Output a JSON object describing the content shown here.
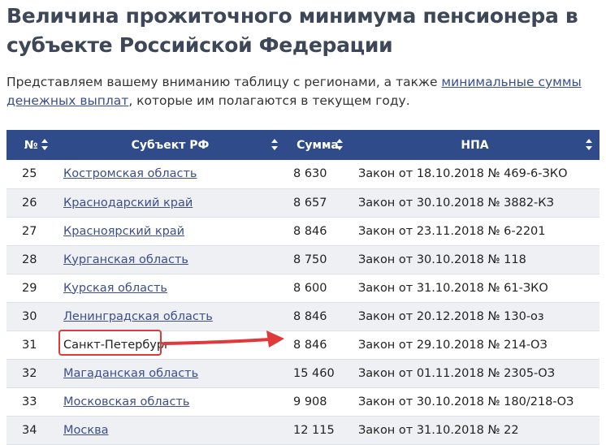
{
  "page": {
    "title": "Величина прожиточного минимума пенсионера в субъекте Российской Федерации",
    "intro_before": "Представляем вашему вниманию таблицу с регионами, а также ",
    "intro_link": "минимальные суммы денежных выплат",
    "intro_after": ", которые им полагаются в текущем году."
  },
  "table": {
    "headers": {
      "num": "№",
      "region": "Субъект РФ",
      "sum": "Сумма",
      "npa": "НПА"
    },
    "rows": [
      {
        "num": "25",
        "region": "Костромская область",
        "sum": "8 630",
        "npa": "Закон от 18.10.2018 № 469-6-ЗКО"
      },
      {
        "num": "26",
        "region": "Краснодарский край",
        "sum": "8 657",
        "npa": "Закон от 30.10.2018 № 3882-КЗ"
      },
      {
        "num": "27",
        "region": "Красноярский край",
        "sum": "8 846",
        "npa": "Закон от 23.11.2018 № 6-2201"
      },
      {
        "num": "28",
        "region": "Курганская область",
        "sum": "8 750",
        "npa": "Закон от 30.10.2018 № 118"
      },
      {
        "num": "29",
        "region": "Курская область",
        "sum": "8 600",
        "npa": "Закон от 31.10.2018 № 61-ЗКО"
      },
      {
        "num": "30",
        "region": "Ленинградская область",
        "sum": "8 846",
        "npa": "Закон от 20.12.2018 № 130-оз"
      },
      {
        "num": "31",
        "region": "Санкт-Петербург",
        "sum": "8 846",
        "npa": "Закон от 29.10.2018 № 214-ОЗ"
      },
      {
        "num": "32",
        "region": "Магаданская область",
        "sum": "15 460",
        "npa": "Закон от 01.11.2018 № 2305-ОЗ"
      },
      {
        "num": "33",
        "region": "Московская область",
        "sum": "9 908",
        "npa": "Закон от 30.10.2018 № 180/218-ОЗ"
      },
      {
        "num": "34",
        "region": "Москва",
        "sum": "12 115",
        "npa": "Закон от 31.10.2018 № 22"
      }
    ]
  },
  "colors": {
    "header_bg": "#2f4b8a",
    "highlight": "#e0393a",
    "stripe": "#eef0f4"
  }
}
